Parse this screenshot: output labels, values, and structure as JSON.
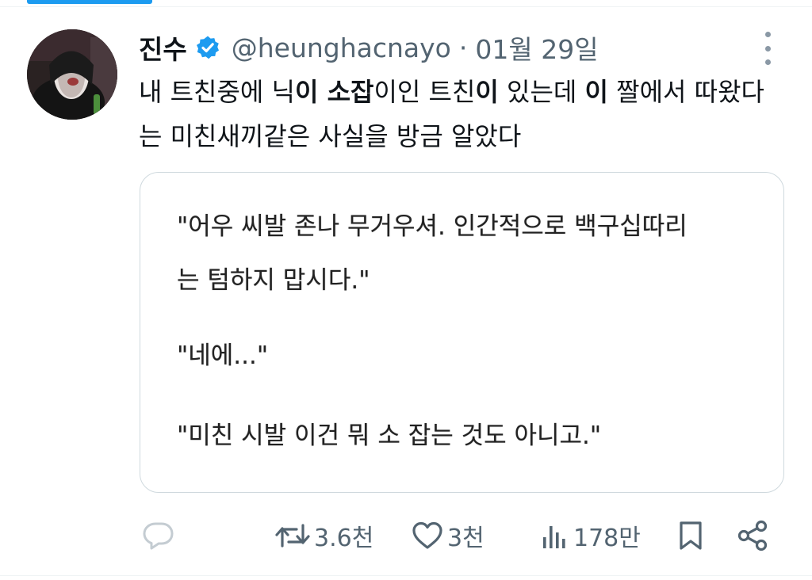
{
  "tweet": {
    "display_name": "진수",
    "verified": true,
    "handle": "@heunghacnayo",
    "separator": "·",
    "date": "01월 29일",
    "text_segments": [
      {
        "text": "내 트친중에 닉",
        "bold": false
      },
      {
        "text": "이 소잡",
        "bold": true
      },
      {
        "text": "이인 트친",
        "bold": false
      },
      {
        "text": "이",
        "bold": true
      },
      {
        "text": " 있는데 ",
        "bold": false
      },
      {
        "text": "이",
        "bold": true
      },
      {
        "text": " 짤에서 따왔다는 미친새끼같은 사실을 방금 알았다",
        "bold": false
      }
    ]
  },
  "quote": {
    "lines": [
      "\"어우 씨발 존나 무거우셔. 인간적으로 백구십따리",
      "는 텀하지 맙시다.\"",
      "\"네에...\"",
      "\"미친 시발 이건 뭐 소 잡는 것도 아니고.\""
    ]
  },
  "actions": {
    "reply": {
      "icon": "reply-icon",
      "count": ""
    },
    "retweet": {
      "icon": "retweet-icon",
      "count": "3.6천"
    },
    "like": {
      "icon": "heart-icon",
      "count": "3천"
    },
    "views": {
      "icon": "views-icon",
      "count": "178만"
    },
    "bookmark": {
      "icon": "bookmark-icon"
    },
    "share": {
      "icon": "share-icon"
    }
  },
  "colors": {
    "accent": "#1d9bf0",
    "muted": "#536471",
    "text": "#0f1419",
    "border": "#cfd9de"
  }
}
